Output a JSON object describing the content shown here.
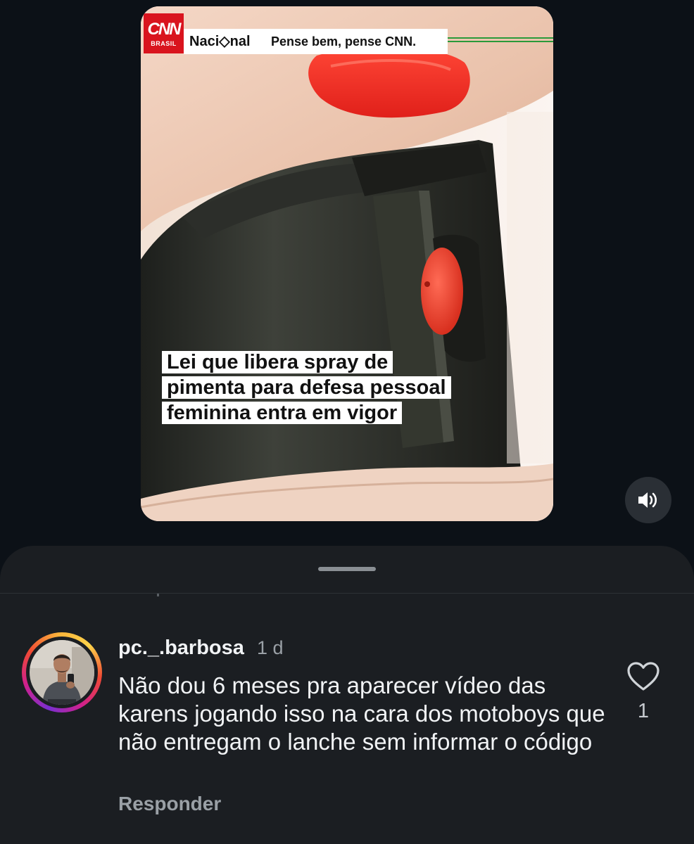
{
  "video": {
    "brand_logo_text": "CNN",
    "brand_logo_subtext": "BRASIL",
    "channel": "Naci◇nal",
    "slogan": "Pense bem, pense CNN.",
    "headline_lines": [
      "Lei que libera spray de",
      "pimenta para defesa pessoal",
      "feminina entra em vigor"
    ],
    "accent_color": "#d9141e",
    "line_color": "#2a9a3a"
  },
  "controls": {
    "mute_icon": "speaker-volume-icon"
  },
  "comments": {
    "sheet_handle_icon": "drag-handle",
    "items": [
      {
        "username": "pc._.barbosa",
        "time": "1 d",
        "text": "Não dou 6 meses pra aparecer vídeo das karens jogando isso na cara dos motoboys que não entregam o lanche sem informar o código",
        "reply_label": "Responder",
        "like_icon": "heart-outline-icon",
        "like_count": "1",
        "avatar_ring_colors": [
          "#7a2fd0",
          "#d0208c",
          "#f04a34",
          "#fbb33a"
        ]
      }
    ]
  }
}
